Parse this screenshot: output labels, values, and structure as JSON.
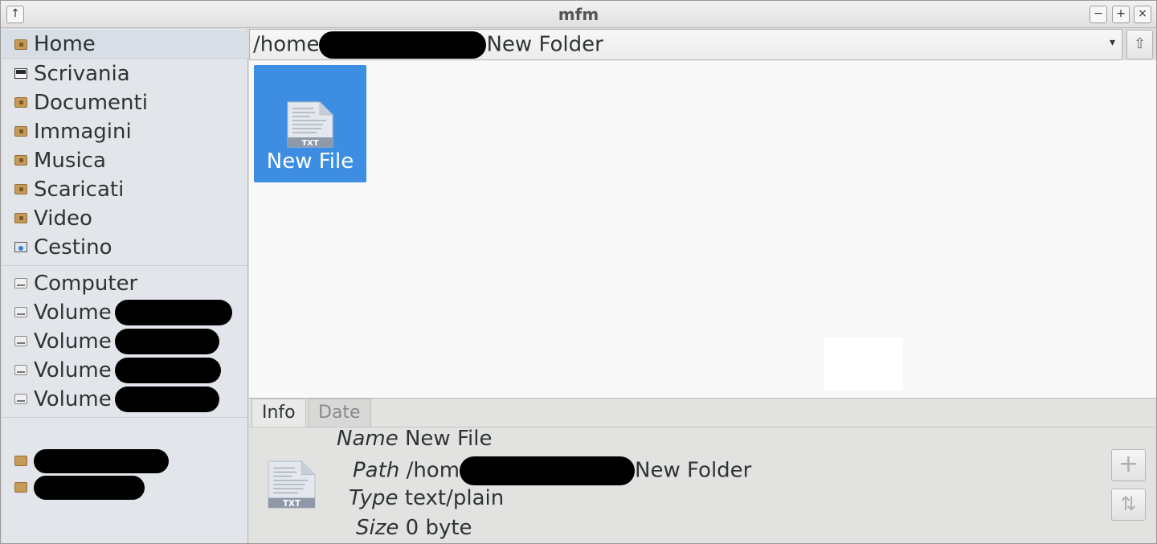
{
  "window": {
    "title": "mfm",
    "controls": {
      "pin": "↑",
      "minimize": "−",
      "maximize": "+",
      "close": "×"
    }
  },
  "sidebar": {
    "places": [
      {
        "label": "Home",
        "icon": "home-folder-icon"
      },
      {
        "label": "Scrivania",
        "icon": "desktop-icon"
      },
      {
        "label": "Documenti",
        "icon": "documents-folder-icon"
      },
      {
        "label": "Immagini",
        "icon": "pictures-folder-icon"
      },
      {
        "label": "Musica",
        "icon": "music-folder-icon"
      },
      {
        "label": "Scaricati",
        "icon": "downloads-folder-icon"
      },
      {
        "label": "Video",
        "icon": "videos-folder-icon"
      },
      {
        "label": "Cestino",
        "icon": "trash-icon"
      }
    ],
    "devices": [
      {
        "label": "Computer",
        "icon": "drive-icon"
      },
      {
        "label": "Volume",
        "icon": "drive-icon"
      },
      {
        "label": "Volume",
        "icon": "drive-icon"
      },
      {
        "label": "Volume",
        "icon": "drive-icon"
      },
      {
        "label": "Volume",
        "icon": "drive-icon"
      }
    ],
    "bookmarks": [
      {
        "icon": "folder-icon"
      },
      {
        "icon": "folder-icon"
      }
    ]
  },
  "pathbar": {
    "prefix": "/home",
    "suffix": "New Folder",
    "dropdown_icon": "▾",
    "up_icon": "⇧"
  },
  "files": [
    {
      "name": "New File",
      "type_badge": "TXT",
      "selected": true
    }
  ],
  "info": {
    "tabs": [
      "Info",
      "Date"
    ],
    "active_tab": "Info",
    "type_badge": "TXT",
    "rows": {
      "name_key": "Name",
      "name_val": "New File",
      "path_key": "Path",
      "path_prefix": "/hom",
      "path_suffix": "New Folder",
      "type_key": "Type",
      "type_val": "text/plain",
      "size_key": "Size",
      "size_val": "0 byte"
    },
    "buttons": {
      "add": "+",
      "sort": "⇅"
    }
  },
  "colors": {
    "selection": "#3d8ee3",
    "sidebar_bg": "#e2e5ea",
    "view_bg": "#f8f8f8"
  }
}
